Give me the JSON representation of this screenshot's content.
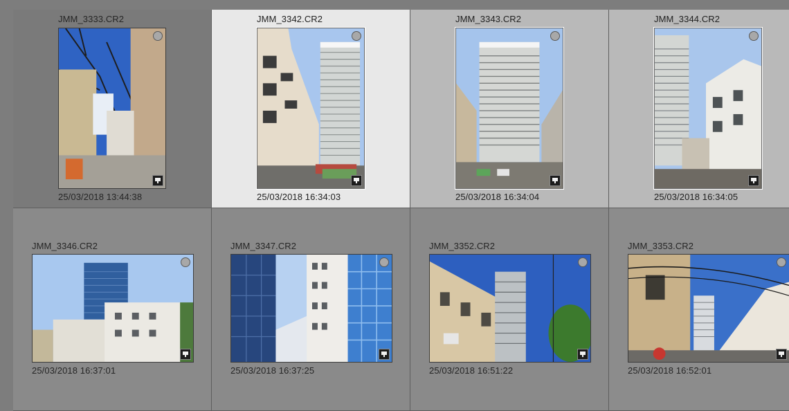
{
  "grid": {
    "cells": [
      {
        "filename": "JMM_3333.CR2",
        "datetime": "25/03/2018 13:44:38",
        "selected": false,
        "orientation": "portrait"
      },
      {
        "filename": "JMM_3342.CR2",
        "datetime": "25/03/2018 16:34:03",
        "selected": true,
        "orientation": "portrait"
      },
      {
        "filename": "JMM_3343.CR2",
        "datetime": "25/03/2018 16:34:04",
        "selected": false,
        "orientation": "portrait"
      },
      {
        "filename": "JMM_3344.CR2",
        "datetime": "25/03/2018 16:34:05",
        "selected": false,
        "orientation": "portrait"
      },
      {
        "filename": "JMM_3346.CR2",
        "datetime": "25/03/2018 16:37:01",
        "selected": false,
        "orientation": "landscape"
      },
      {
        "filename": "JMM_3347.CR2",
        "datetime": "25/03/2018 16:37:25",
        "selected": false,
        "orientation": "landscape"
      },
      {
        "filename": "JMM_3352.CR2",
        "datetime": "25/03/2018 16:51:22",
        "selected": false,
        "orientation": "landscape"
      },
      {
        "filename": "JMM_3353.CR2",
        "datetime": "25/03/2018 16:52:01",
        "selected": false,
        "orientation": "landscape"
      }
    ]
  },
  "icons": {
    "pick_flag": "circle-flag-icon",
    "metadata_badge": "comment-badge-icon"
  },
  "colors": {
    "cell_dark": "#7a7a7a",
    "cell_selected": "#e8e8e8",
    "cell_light": "#b9b9b9",
    "cell_mid": "#8a8a8a",
    "cell_low": "#8c8c8c"
  }
}
